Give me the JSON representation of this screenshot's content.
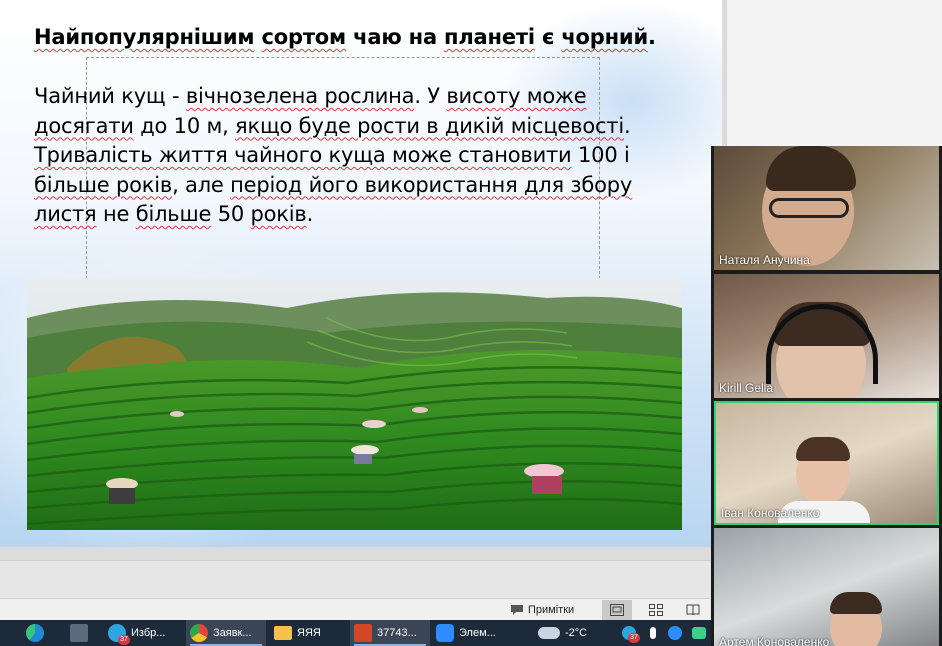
{
  "slide": {
    "title_prefix": "Найпопулярнішим",
    "title_mid": "сортом",
    "title_rest": "чаю на",
    "title_planet": "планеті",
    "title_tail": "є",
    "title_black": "чорний",
    "title_dot": ".",
    "body": [
      {
        "t": "Чайний кущ - ",
        "u": false
      },
      {
        "t": "вічнозелена рослина",
        "u": true
      },
      {
        "t": ". У ",
        "u": false
      },
      {
        "t": "висоту може",
        "u": true
      },
      {
        "t": " ",
        "u": false
      },
      {
        "t": "досягати",
        "u": true
      },
      {
        "t": " до 10 м, ",
        "u": false
      },
      {
        "t": "якщо буде рости в дикій місцевості",
        "u": true
      },
      {
        "t": ". ",
        "u": false
      },
      {
        "t": "Тривалість життя чайного куща може становити",
        "u": true
      },
      {
        "t": " 100 і ",
        "u": false
      },
      {
        "t": "більше років",
        "u": true
      },
      {
        "t": ", але ",
        "u": false
      },
      {
        "t": "період його використання для збору",
        "u": true
      },
      {
        "t": " ",
        "u": false
      },
      {
        "t": "листя",
        "u": true
      },
      {
        "t": " не ",
        "u": false
      },
      {
        "t": "більше",
        "u": true
      },
      {
        "t": " 50 ",
        "u": false
      },
      {
        "t": "років",
        "u": true
      },
      {
        "t": ".",
        "u": false
      }
    ]
  },
  "status_bar": {
    "notes_label": "Примітки",
    "notes_icon": "comment-icon",
    "views": [
      "normal-view-icon",
      "slide-sorter-icon",
      "reading-view-icon"
    ]
  },
  "participants": [
    {
      "name": "Наталя Анучина",
      "active": false
    },
    {
      "name": "Kirill Gella",
      "active": false
    },
    {
      "name": "Іван Коноваленко",
      "active": true
    },
    {
      "name": "Артем Коноваленко",
      "active": false
    }
  ],
  "taskbar": {
    "items": [
      {
        "icon": "edge-icon",
        "label": "",
        "color": "#1f8ad8"
      },
      {
        "icon": "calculator-icon",
        "label": "",
        "color": "#5a6b80"
      },
      {
        "icon": "telegram-icon",
        "label": "Избр...",
        "color": "#2ea6e0",
        "badge": "37"
      },
      {
        "icon": "chrome-icon",
        "label": "Заявк...",
        "color": "#e2463b",
        "active": true
      },
      {
        "icon": "folder-icon",
        "label": "ЯЯЯ",
        "color": "#f2c14e"
      },
      {
        "icon": "powerpoint-icon",
        "label": "37743...",
        "color": "#d24726",
        "active": true
      },
      {
        "icon": "zoom-icon",
        "label": "Элем...",
        "color": "#2d8cff"
      }
    ],
    "weather_icon": "cloud-icon",
    "temperature": "-2°C",
    "tray_badge": "37"
  },
  "colors": {
    "active_speaker_border": "#2fd46b",
    "taskbar_bg": "#1d2a3a",
    "spellcheck": "#e0393e"
  }
}
